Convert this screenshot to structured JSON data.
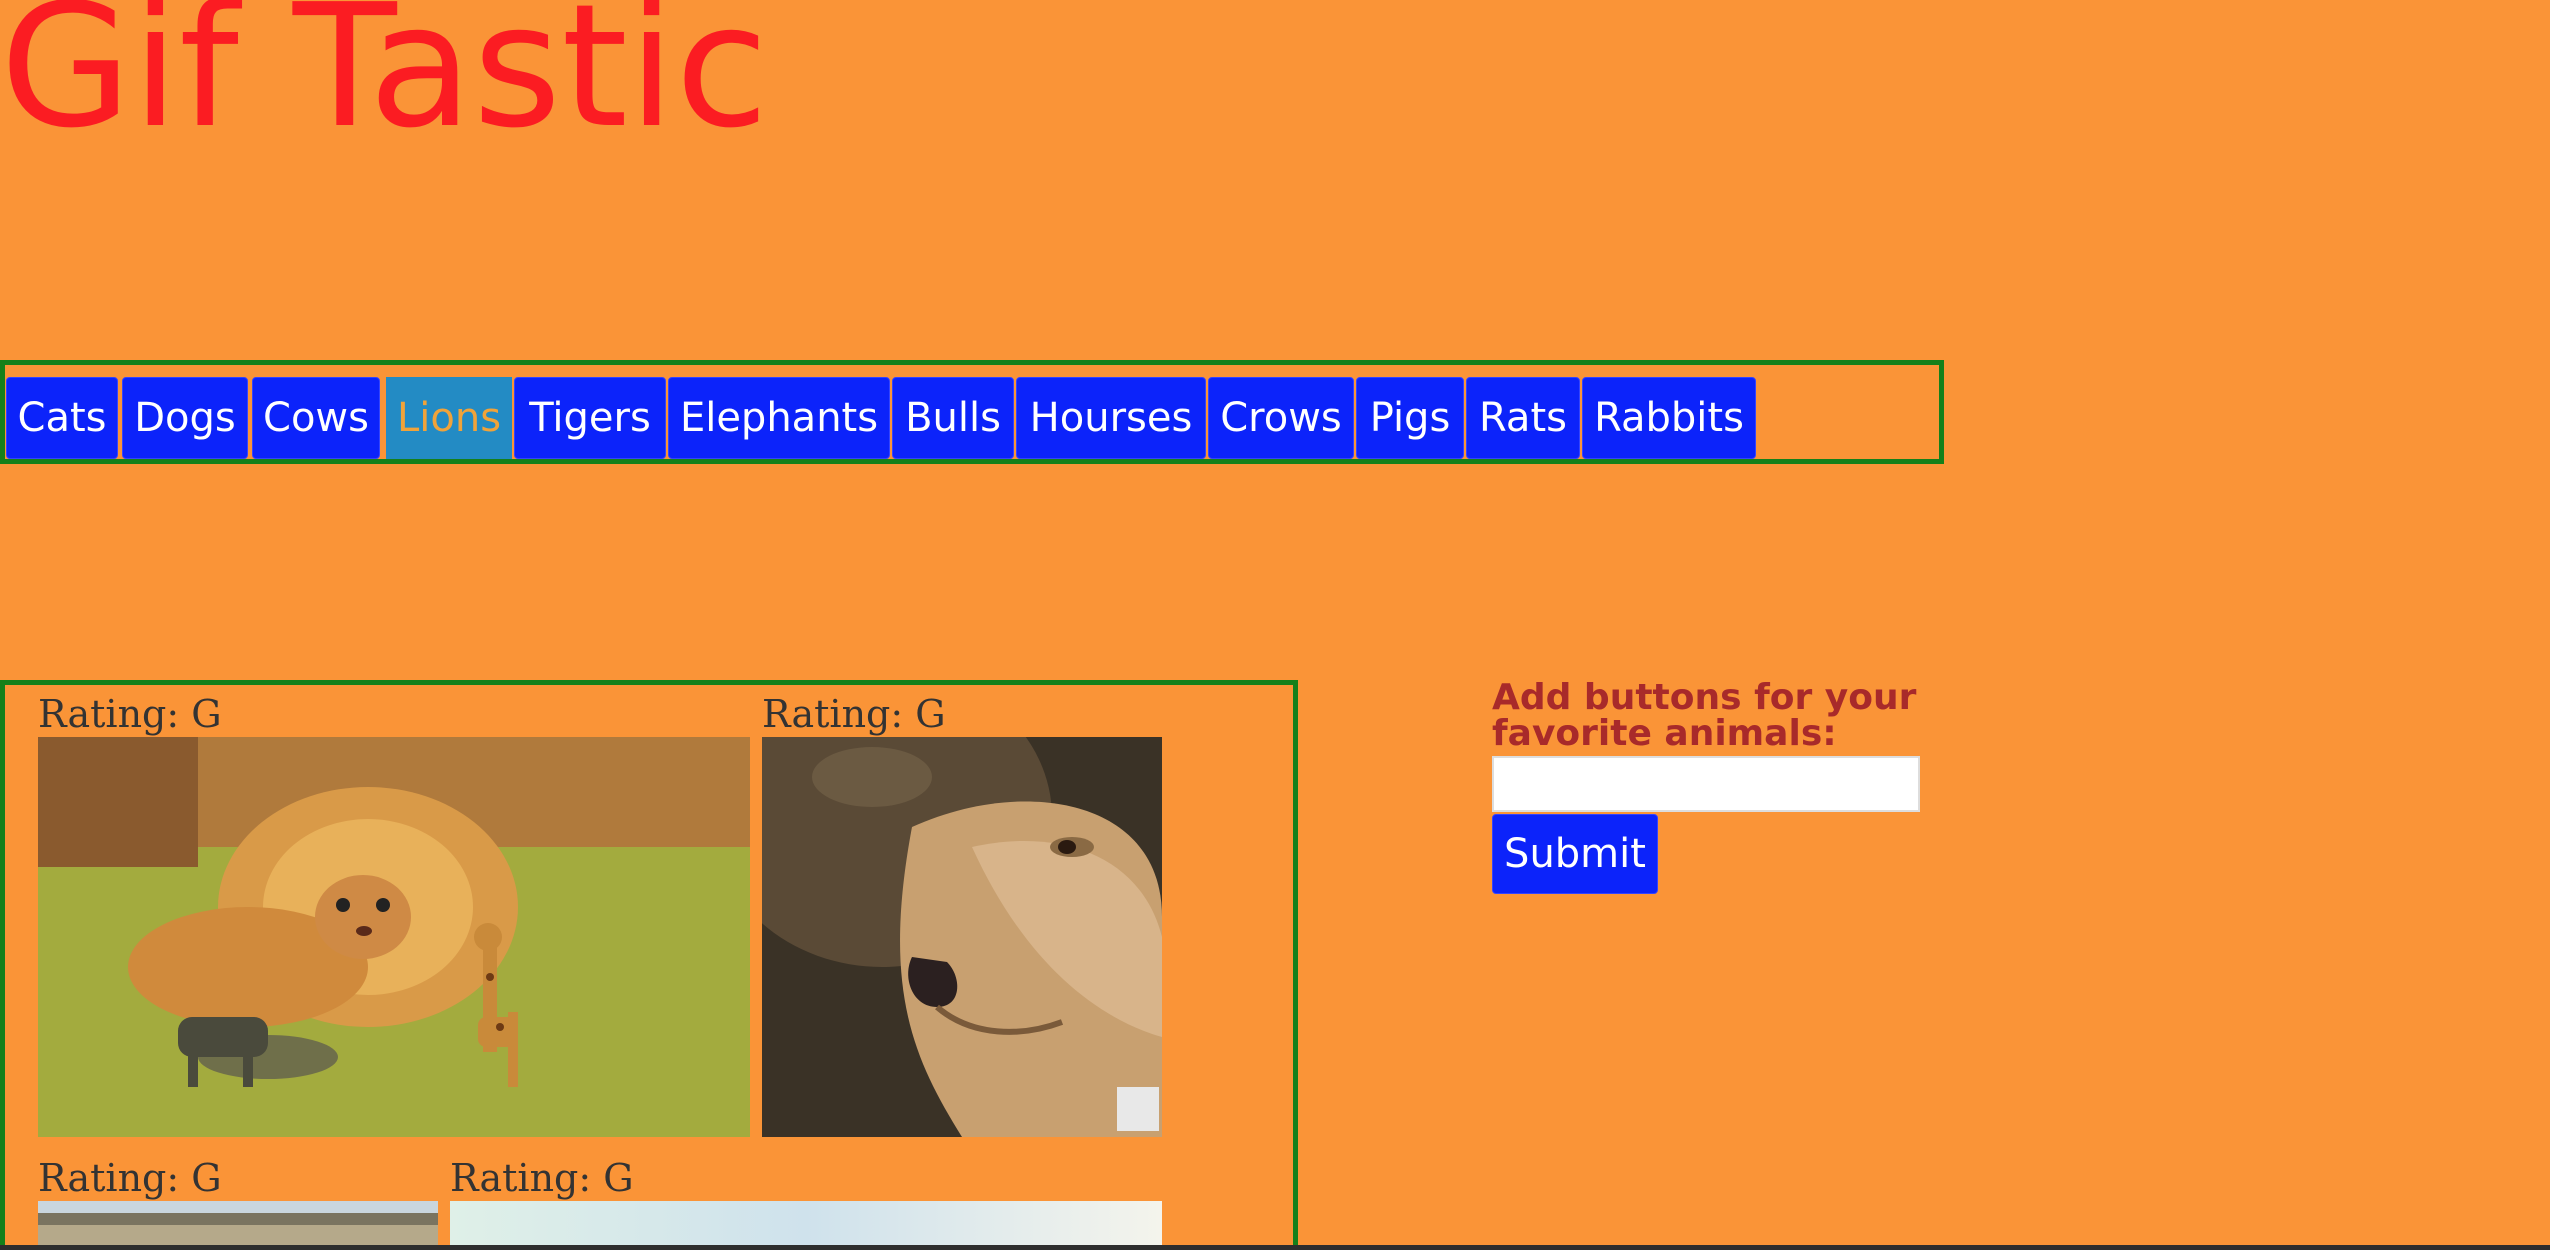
{
  "page": {
    "title": "Gif Tastic",
    "background_color": "#fa9437",
    "title_color": "#fb1c22",
    "button_color": "#0c23fa",
    "active_button_color": "#238bc4",
    "border_color": "#15801a"
  },
  "animal_buttons": [
    {
      "label": "Cats"
    },
    {
      "label": "Dogs"
    },
    {
      "label": "Cows"
    },
    {
      "label": "Lions",
      "active": true
    },
    {
      "label": "Tigers"
    },
    {
      "label": "Elephants"
    },
    {
      "label": "Bulls"
    },
    {
      "label": "Hourses"
    },
    {
      "label": "Crows"
    },
    {
      "label": "Pigs"
    },
    {
      "label": "Rats"
    },
    {
      "label": "Rabbits"
    }
  ],
  "gifs": [
    {
      "rating": "Rating: G",
      "image": "cat-in-lion-mane-with-toy-animals"
    },
    {
      "rating": "Rating: G",
      "image": "lioness-close-up"
    },
    {
      "rating": "Rating: G",
      "image": "savanna-landscape"
    },
    {
      "rating": "Rating: G",
      "image": "pale-sky-scene"
    }
  ],
  "add_form": {
    "label": "Add buttons for your favorite animals:",
    "input_value": "",
    "submit_label": "Submit"
  }
}
